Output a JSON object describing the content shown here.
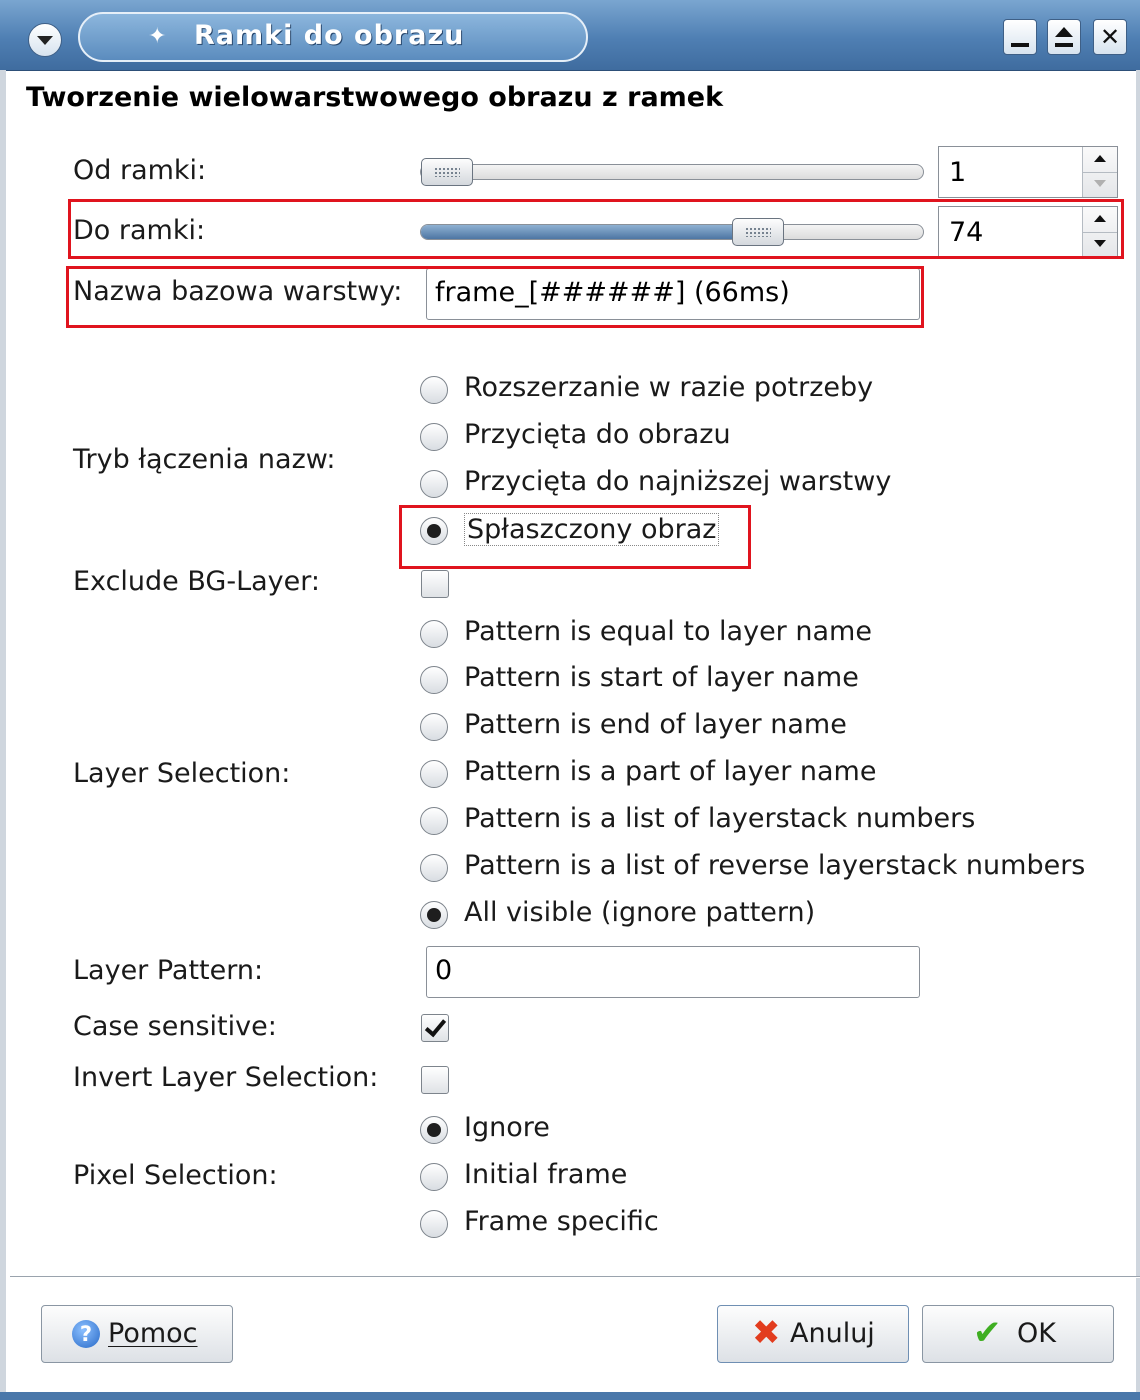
{
  "window": {
    "title": "Ramki do obrazu",
    "heading": "Tworzenie wielowarstwowego obrazu z ramek"
  },
  "icons": {
    "window_menu": "chevron-down-icon",
    "app": "gimp-icon",
    "minimize": "minimize-icon",
    "maximize": "maximize-icon",
    "close": "close-icon",
    "help": "help-icon",
    "cancel": "cancel-icon",
    "ok": "check-icon",
    "close_glyph": "✕"
  },
  "from_frame": {
    "label": "Od ramki:",
    "value": "1",
    "slider_fraction": 0
  },
  "to_frame": {
    "label": "Do ramki:",
    "value": "74",
    "slider_fraction": 0.69
  },
  "layer_basename": {
    "label": "Nazwa bazowa warstwy:",
    "value": "frame_[######] (66ms)"
  },
  "merge_mode": {
    "label": "Tryb łączenia nazw:",
    "options": [
      {
        "label": "Rozszerzanie w razie potrzeby",
        "selected": false
      },
      {
        "label": "Przycięta do obrazu",
        "selected": false
      },
      {
        "label": "Przycięta do najniższej warstwy",
        "selected": false
      },
      {
        "label": "Spłaszczony obraz",
        "selected": true
      }
    ]
  },
  "exclude_bg": {
    "label": "Exclude BG-Layer:",
    "checked": false
  },
  "layer_selection": {
    "label": "Layer Selection:",
    "options": [
      {
        "label": "Pattern is equal to layer name",
        "selected": false
      },
      {
        "label": "Pattern is start of layer name",
        "selected": false
      },
      {
        "label": "Pattern is end of layer name",
        "selected": false
      },
      {
        "label": "Pattern is a part of layer name",
        "selected": false
      },
      {
        "label": "Pattern is a list of layerstack numbers",
        "selected": false
      },
      {
        "label": "Pattern is a list of reverse layerstack numbers",
        "selected": false
      },
      {
        "label": "All visible (ignore pattern)",
        "selected": true
      }
    ]
  },
  "layer_pattern": {
    "label": "Layer Pattern:",
    "value": "0"
  },
  "case_sensitive": {
    "label": "Case sensitive:",
    "checked": true
  },
  "invert_selection": {
    "label": "Invert Layer Selection:",
    "checked": false
  },
  "pixel_selection": {
    "label": "Pixel Selection:",
    "options": [
      {
        "label": "Ignore",
        "selected": true
      },
      {
        "label": "Initial frame",
        "selected": false
      },
      {
        "label": "Frame specific",
        "selected": false
      }
    ]
  },
  "buttons": {
    "help": "Pomoc",
    "cancel": "Anuluj",
    "ok": "OK"
  },
  "annotation_color": "#e0141e"
}
